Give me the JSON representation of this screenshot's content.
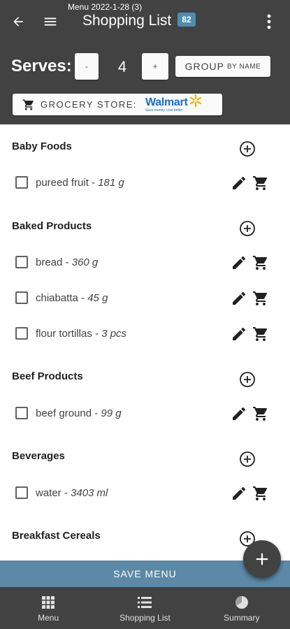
{
  "header": {
    "subtitle": "Menu 2022-1-28 (3)",
    "title": "Shopping List",
    "badge": "82",
    "serves_label": "Serves:",
    "minus_label": "-",
    "plus_label": "+",
    "serves_value": "4",
    "group_label": "GROUP",
    "group_sub_label": "BY NAME",
    "store_label": "GROCERY STORE:",
    "store_name": "Walmart",
    "store_tagline": "Save money. Live better."
  },
  "categories": [
    {
      "name": "Baby Foods",
      "items": [
        {
          "name": "pureed fruit - ",
          "qty": "181 g"
        }
      ]
    },
    {
      "name": "Baked Products",
      "items": [
        {
          "name": "bread - ",
          "qty": "360 g"
        },
        {
          "name": "chiabatta - ",
          "qty": "45 g"
        },
        {
          "name": "flour tortillas - ",
          "qty": "3 pcs"
        }
      ]
    },
    {
      "name": "Beef Products",
      "items": [
        {
          "name": "beef ground - ",
          "qty": "99 g"
        }
      ]
    },
    {
      "name": "Beverages",
      "items": [
        {
          "name": "water - ",
          "qty": "3403 ml"
        }
      ]
    },
    {
      "name": "Breakfast Cereals",
      "items": []
    }
  ],
  "save_label": "SAVE MENU",
  "nav": [
    {
      "label": "Menu",
      "icon": "grid-icon"
    },
    {
      "label": "Shopping List",
      "icon": "list-icon"
    },
    {
      "label": "Summary",
      "icon": "pie-chart-icon"
    }
  ],
  "colors": {
    "header_bg": "#424242",
    "accent": "#5b89a6",
    "badge": "#4e8db0",
    "walmart_blue": "#1a6dc7",
    "walmart_yellow": "#f2b300"
  }
}
